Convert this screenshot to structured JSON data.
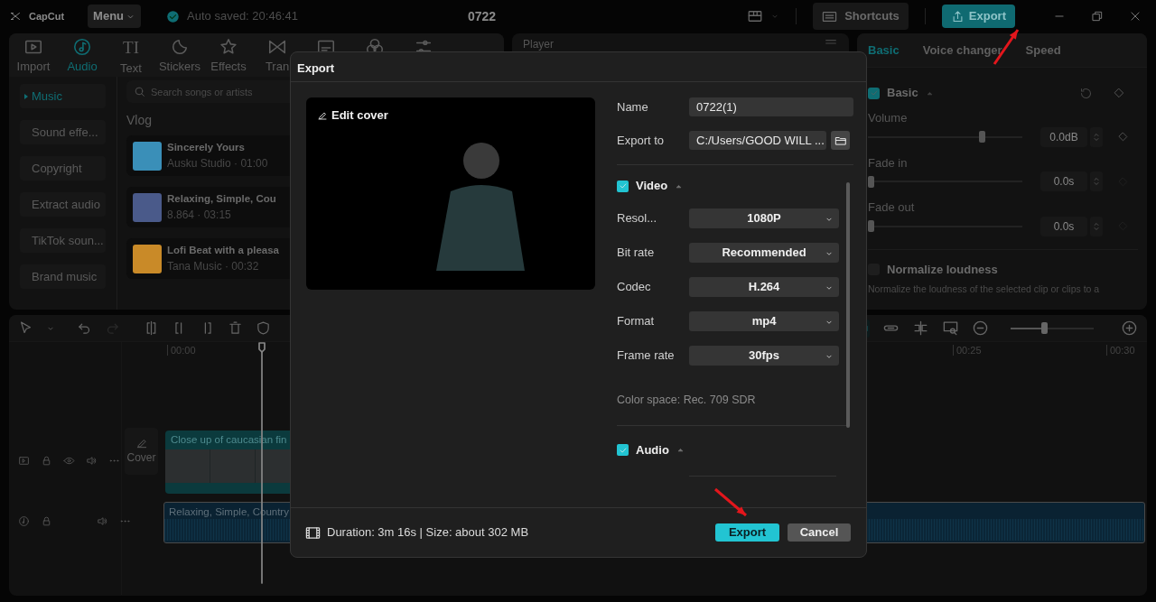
{
  "titlebar": {
    "logo": "CapCut",
    "menu": "Menu",
    "autosave": "Auto saved: 20:46:41",
    "project": "0722",
    "shortcuts": "Shortcuts",
    "export": "Export"
  },
  "media_tabs": [
    {
      "label": "Import",
      "selected": false
    },
    {
      "label": "Audio",
      "selected": true
    },
    {
      "glyph": "TI",
      "label": "Text",
      "selected": false
    },
    {
      "label": "Stickers",
      "selected": false
    },
    {
      "label": "Effects",
      "selected": false
    },
    {
      "label": "Tran",
      "selected": false
    },
    {
      "selected": false
    },
    {
      "selected": false
    },
    {
      "selected": false
    }
  ],
  "audio_categories": [
    {
      "label": "Music",
      "selected": true
    },
    {
      "label": "Sound effe...",
      "selected": false
    },
    {
      "label": "Copyright",
      "selected": false
    },
    {
      "label": "Extract audio",
      "selected": false
    },
    {
      "label": "TikTok soun...",
      "selected": false
    },
    {
      "label": "Brand music",
      "selected": false
    }
  ],
  "search": {
    "placeholder": "Search songs or artists"
  },
  "song_group": "Vlog",
  "songs": [
    {
      "title": "Sincerely Yours",
      "meta": "Ausku Studio · 01:00",
      "color": "#3a8fb8"
    },
    {
      "title": "Relaxing, Simple, Cou",
      "meta": "8.864 · 03:15",
      "color": "#4a5a8a"
    },
    {
      "title": "Lofi Beat with a pleasa",
      "meta": "Tana Music · 00:32",
      "color": "#c98a28"
    }
  ],
  "player": {
    "title": "Player"
  },
  "properties": {
    "tabs": [
      {
        "label": "Basic",
        "selected": true
      },
      {
        "label": "Voice changer",
        "selected": false
      },
      {
        "label": "Speed",
        "selected": false
      }
    ],
    "section": {
      "title": "Basic",
      "checked": true,
      "expanded": true
    },
    "sliders": [
      {
        "label": "Volume",
        "level": 0.75,
        "value": "0.0dB",
        "keyframe": true
      },
      {
        "label": "Fade in",
        "level": 0,
        "value": "0.0s",
        "keyframe": false
      },
      {
        "label": "Fade out",
        "level": 0,
        "value": "0.0s",
        "keyframe": false
      }
    ],
    "normalize": {
      "label": "Normalize loudness",
      "checked": false,
      "description": "Normalize the loudness of the selected clip or clips to a"
    }
  },
  "timeline": {
    "ruler": [
      "00:00",
      "00:25",
      "00:30"
    ],
    "zoom": {
      "level": 0.4
    },
    "cover": "Cover",
    "tracks": [
      {
        "kind": "video",
        "clip": "Close up of caucasian fin"
      },
      {
        "kind": "audio",
        "clip": "Relaxing, Simple, Country"
      }
    ]
  },
  "export_dialog": {
    "title": "Export",
    "edit_cover": "Edit cover",
    "name": {
      "label": "Name",
      "value": "0722(1)"
    },
    "export_to": {
      "label": "Export to",
      "value": "C:/Users/GOOD WILL ..."
    },
    "video": {
      "label": "Video",
      "checked": true,
      "expanded": true,
      "settings": [
        {
          "label": "Resol...",
          "value": "1080P"
        },
        {
          "label": "Bit rate",
          "value": "Recommended"
        },
        {
          "label": "Codec",
          "value": "H.264"
        },
        {
          "label": "Format",
          "value": "mp4"
        },
        {
          "label": "Frame rate",
          "value": "30fps"
        }
      ],
      "color_space": "Color space: Rec. 709 SDR"
    },
    "audio": {
      "label": "Audio",
      "checked": true,
      "expanded": true
    },
    "summary": "Duration: 3m 16s | Size: about 302 MB",
    "buttons": [
      {
        "label": "Export",
        "kind": "primary"
      },
      {
        "label": "Cancel",
        "kind": "secondary"
      }
    ]
  }
}
